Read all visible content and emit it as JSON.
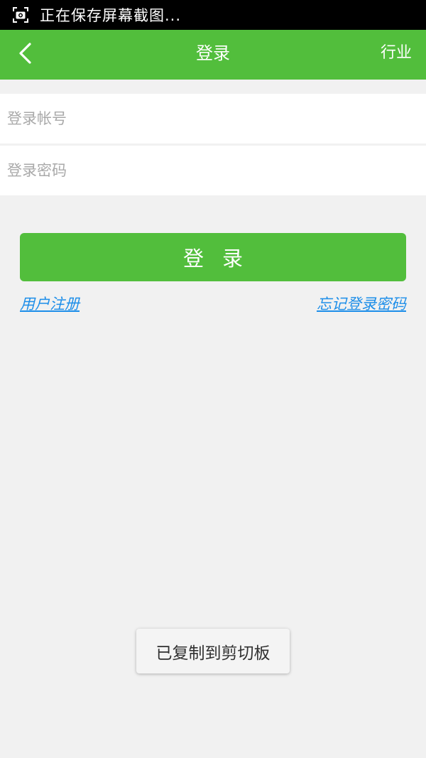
{
  "status_bar": {
    "icon": "screenshot-icon",
    "text": "正在保存屏幕截图..."
  },
  "app_bar": {
    "back_icon": "chevron-left-icon",
    "title": "登录",
    "action": "行业",
    "color": "#52be3c"
  },
  "form": {
    "account": {
      "placeholder": "登录帐号",
      "value": ""
    },
    "password": {
      "placeholder": "登录密码",
      "value": ""
    },
    "login_label": "登录"
  },
  "links": {
    "register": "用户注册",
    "forgot_password": "忘记登录密码"
  },
  "toast": {
    "message": "已复制到剪切板"
  },
  "colors": {
    "accent": "#52be3c",
    "link": "#1d8ee9",
    "background": "#f1f1f1"
  }
}
